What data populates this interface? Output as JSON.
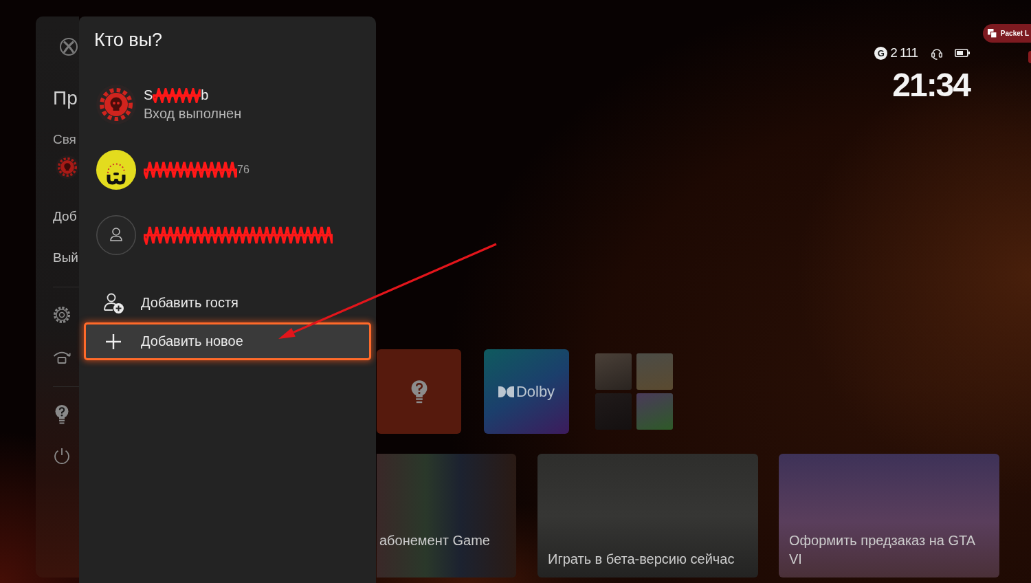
{
  "guide": {
    "title": "Пр",
    "section": "Свя",
    "menu": [
      {
        "label": "Доб"
      },
      {
        "label": "Вый"
      }
    ]
  },
  "dialog": {
    "title": "Кто вы?",
    "accounts": [
      {
        "kind": "gear",
        "name": [
          {
            "kind": "text",
            "text": "S"
          },
          {
            "kind": "scribble"
          },
          {
            "kind": "text",
            "text": "b"
          }
        ],
        "status": "Вход выполнен",
        "selected": false
      },
      {
        "kind": "character",
        "name": [
          {
            "kind": "scribble"
          },
          {
            "kind": "suffix",
            "text": "76"
          }
        ],
        "selected": false
      },
      {
        "kind": "placeholder",
        "name": [
          {
            "kind": "scribble"
          }
        ],
        "selected": false
      }
    ],
    "actions": [
      {
        "kind": "guest",
        "label": "Добавить гостя",
        "selected": false
      },
      {
        "kind": "new",
        "label": "Добавить новое",
        "selected": true
      }
    ]
  },
  "status": {
    "gamerscore_badge": "G",
    "gamerscore": "2 111",
    "time": "21:34"
  },
  "overlay_badge": {
    "label": "Packet L"
  },
  "tiles": [
    {
      "kind": "tips"
    },
    {
      "kind": "dolby",
      "label": "Dolby"
    },
    {
      "kind": "collection"
    }
  ],
  "cards": [
    {
      "caption": "абонемент Game"
    },
    {
      "caption": "Играть в бета-версию сейчас"
    },
    {
      "caption": "Оформить предзаказ на GTA VI"
    }
  ]
}
